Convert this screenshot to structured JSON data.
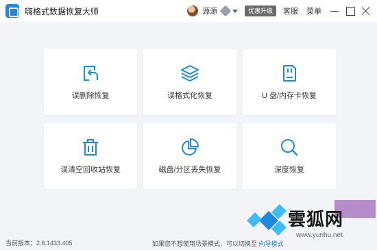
{
  "app": {
    "title": "嗨格式数据恢复大师"
  },
  "header": {
    "username": "源源",
    "upgrade_label": "优惠升级",
    "service_label": "客服",
    "menu_label": "菜单"
  },
  "cards": [
    {
      "label": "误删除恢复",
      "icon": "undo-arrow-icon"
    },
    {
      "label": "误格式化恢复",
      "icon": "layers-icon"
    },
    {
      "label": "U 盘/内存卡恢复",
      "icon": "sd-card-icon"
    },
    {
      "label": "误清空回收站恢复",
      "icon": "trash-icon"
    },
    {
      "label": "磁盘/分区丢失恢复",
      "icon": "pie-chart-icon"
    },
    {
      "label": "深度恢复",
      "icon": "search-icon"
    }
  ],
  "footer": {
    "version": "当前版本：2.8.1433.405",
    "hint": "如果您不想使用场景模式，可以切换至",
    "guide_link": "向导模式"
  },
  "watermark": {
    "text": "雲狐网",
    "url": "www.yunhu.net"
  },
  "colors": {
    "accent": "#1e88e5",
    "background": "#f2f4f7",
    "card": "#ffffff"
  }
}
